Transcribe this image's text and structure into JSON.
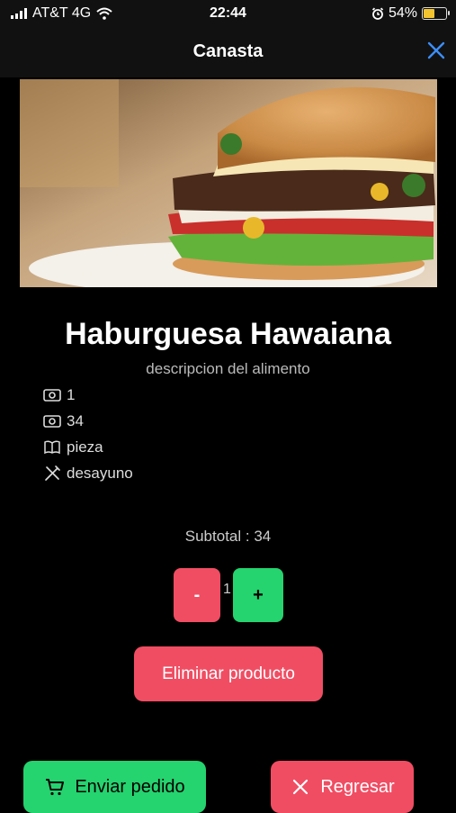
{
  "status_bar": {
    "carrier": "AT&T 4G",
    "time": "22:44",
    "battery": "54%",
    "battery_level": 0.54
  },
  "nav": {
    "title": "Canasta"
  },
  "product": {
    "name": "Haburguesa Hawaiana",
    "description": "descripcion del alimento",
    "details": [
      {
        "icon": "money-icon",
        "value": "1"
      },
      {
        "icon": "money-icon",
        "value": "34"
      },
      {
        "icon": "book-icon",
        "value": "pieza"
      },
      {
        "icon": "utensils-icon",
        "value": "desayuno"
      }
    ]
  },
  "subtotal": "Subtotal : 34",
  "quantity": {
    "minus_label": "-",
    "value": "1",
    "plus_label": "+"
  },
  "buttons": {
    "delete_label": "Eliminar producto",
    "send_label": "Enviar pedido",
    "back_label": "Regresar"
  },
  "colors": {
    "accent_red": "#f04d63",
    "accent_green": "#25d36f",
    "close_blue": "#3d8ef7"
  }
}
